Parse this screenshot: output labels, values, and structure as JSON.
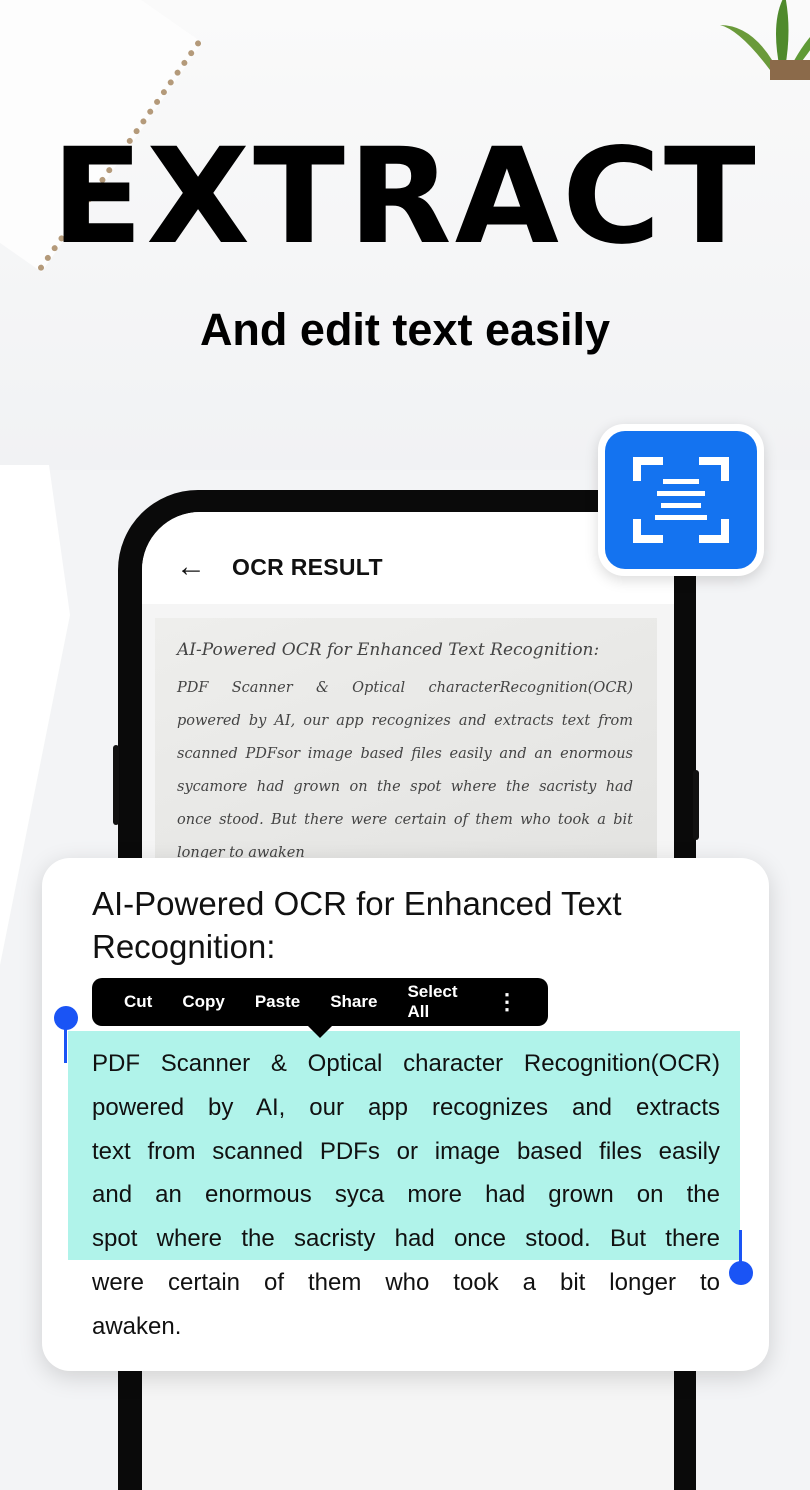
{
  "hero": {
    "title": "EXTRACT",
    "subtitle": "And edit text easily"
  },
  "colors": {
    "accent": "#1473f0",
    "selection": "#b0f3ea",
    "handle": "#1a54f5"
  },
  "app": {
    "back_icon": "arrow-left-icon",
    "title": "OCR RESULT",
    "badge_icon": "document-scan-icon"
  },
  "scanned": {
    "title": "AI-Powered OCR for Enhanced Text Recognition:",
    "lines": [
      "PDF Scanner & Optical characterRecognition(OCR)",
      "powered by AI, our app recognizes and extracts text from",
      "scanned PDFsor image based files easily and an enormous",
      "sycamore had grown on the  spot where the sacristy had",
      "once stood. But there were certain of them who took a bit",
      "longer to awaken"
    ]
  },
  "result": {
    "title": "AI-Powered OCR for Enhanced Text Recognition:",
    "menu": [
      "Cut",
      "Copy",
      "Paste",
      "Share",
      "Select All"
    ],
    "more_icon": "more-vertical-icon",
    "lines": [
      "PDF Scanner & Optical character Recognition(OCR)",
      "powered by AI, our app recognizes and extracts",
      "text from scanned PDFs or image based files easily",
      "and an enormous syca more had grown on the",
      "spot where the sacristy had once stood. But there",
      "were certain of them who took a bit  longer to",
      "awaken."
    ]
  }
}
